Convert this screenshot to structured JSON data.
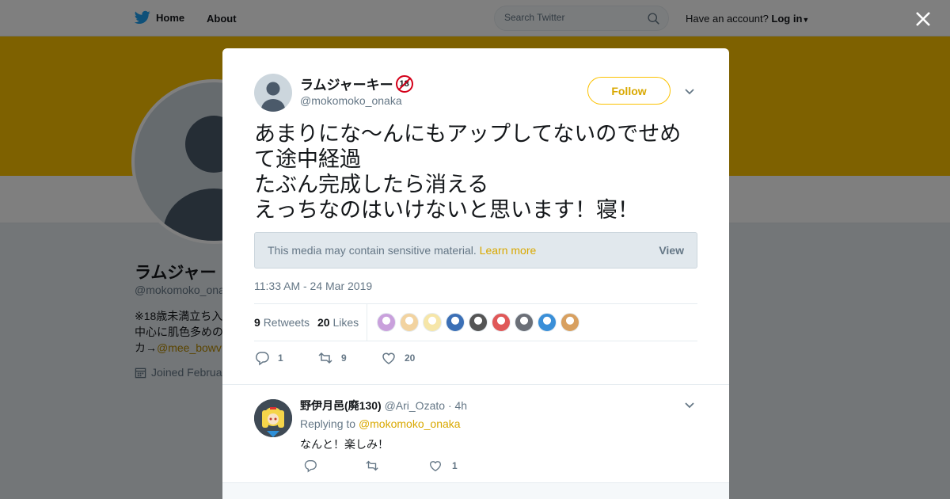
{
  "nav": {
    "home_label": "Home",
    "about_label": "About",
    "search_placeholder": "Search Twitter",
    "account_prompt": "Have an account?",
    "login_label": "Log in"
  },
  "profile": {
    "name": "ラムジャー",
    "handle": "@mokomoko_ona",
    "bio_line1": "※18歳未満立ち入",
    "bio_line2": "中心に肌色多めの",
    "bio_line3_prefix": "カ→",
    "bio_link": "@mee_bowv",
    "joined": "Joined Februa"
  },
  "tweet": {
    "author_name": "ラムジャーキー",
    "author_badge": "18",
    "author_handle": "@mokomoko_onaka",
    "follow_label": "Follow",
    "text": "あまりにな〜んにもアップしてないのでせめて途中経過\nたぶん完成したら消える\nえっちなのはいけないと思います！寝！",
    "sensitive_message": "This media may contain sensitive material.",
    "sensitive_learn_more": "Learn more",
    "sensitive_view": "View",
    "timestamp": "11:33 AM - 24 Mar 2019",
    "retweets_count": "9",
    "retweets_label": "Retweets",
    "likes_count": "20",
    "likes_label": "Likes",
    "action_reply_count": "1",
    "action_retweet_count": "9",
    "action_like_count": "20"
  },
  "likers": [
    {
      "color": "#c9a0dc"
    },
    {
      "color": "#f2d3a0"
    },
    {
      "color": "#f6e6a8"
    },
    {
      "color": "#3b6fb6"
    },
    {
      "color": "#555555"
    },
    {
      "color": "#e05858"
    },
    {
      "color": "#6b6f77"
    },
    {
      "color": "#3a8fd8"
    },
    {
      "color": "#d8a060"
    }
  ],
  "reply": {
    "name": "野伊月邑(廃130)",
    "handle": "@Ari_Ozato",
    "time": "· 4h",
    "replying_to_label": "Replying to",
    "replying_to_handle": "@mokomoko_onaka",
    "text": "なんと！楽しみ！",
    "like_count": "1"
  },
  "colors": {
    "accent": "#fcc200",
    "link": "#d9a800",
    "twitter_blue": "#1da1f2"
  }
}
